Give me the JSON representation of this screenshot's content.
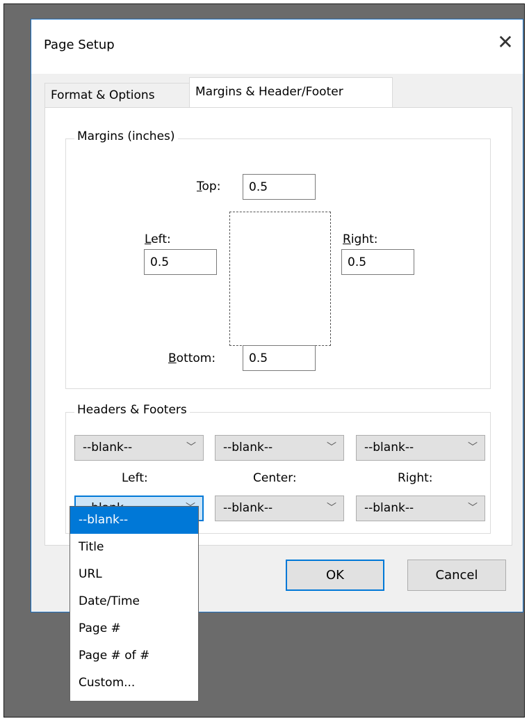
{
  "dialog": {
    "title": "Page Setup",
    "close_glyph": "✕"
  },
  "tabs": [
    {
      "label": "Format & Options",
      "active": false
    },
    {
      "label": "Margins & Header/Footer",
      "active": true
    }
  ],
  "margins": {
    "legend": "Margins (inches)",
    "top": {
      "mnemonic": "T",
      "rest": "op:",
      "value": "0.5"
    },
    "left": {
      "mnemonic": "L",
      "rest": "eft:",
      "value": "0.5"
    },
    "right": {
      "mnemonic": "R",
      "rest": "ight:",
      "value": "0.5"
    },
    "bottom": {
      "mnemonic": "B",
      "rest": "ottom:",
      "value": "0.5"
    }
  },
  "headers_footers": {
    "legend": "Headers & Footers",
    "header_selects": [
      "--blank--",
      "--blank--",
      "--blank--"
    ],
    "footer_selects": [
      "--blank--",
      "--blank--",
      "--blank--"
    ],
    "column_labels": [
      "Left:",
      "Center:",
      "Right:"
    ],
    "chevron": "﹀"
  },
  "dropdown": {
    "options": [
      "--blank--",
      "Title",
      "URL",
      "Date/Time",
      "Page #",
      "Page # of #",
      "Custom..."
    ],
    "selected_index": 0
  },
  "buttons": {
    "ok": "OK",
    "cancel": "Cancel"
  },
  "colors": {
    "accent": "#0078d7",
    "backdrop": "#6b6b6b",
    "dialog_bg": "#f0f0f0"
  }
}
